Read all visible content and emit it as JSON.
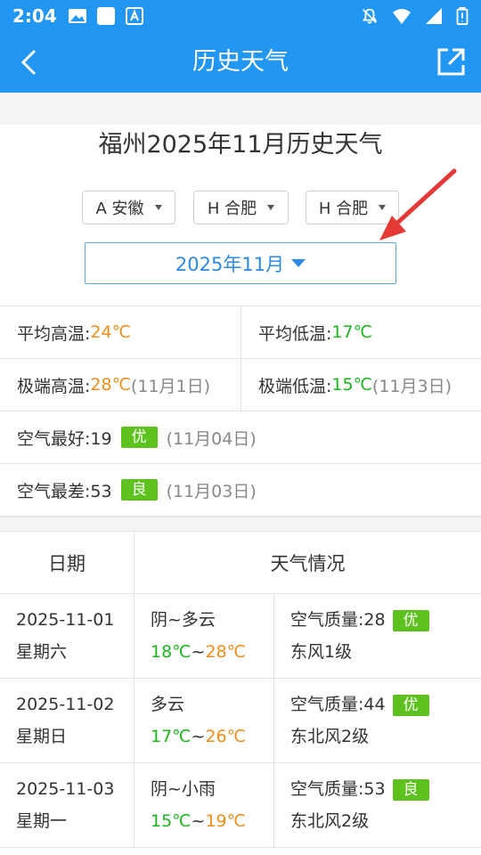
{
  "status": {
    "time": "2:04"
  },
  "app_bar": {
    "title": "历史天气"
  },
  "heading": "福州2025年11月历史天气",
  "selectors": {
    "province": "A 安徽",
    "city": "H 合肥",
    "district": "H 合肥",
    "month": "2025年11月"
  },
  "stats": {
    "avg_high_label": "平均高温:",
    "avg_high": "24℃",
    "avg_low_label": "平均低温:",
    "avg_low": "17℃",
    "ext_high_label": "极端高温:",
    "ext_high": "28℃",
    "ext_high_date": "(11月1日)",
    "ext_low_label": "极端低温:",
    "ext_low": "15℃",
    "ext_low_date": "(11月3日)",
    "air_best_label": "空气最好:19",
    "air_best_badge": "优",
    "air_best_date": "(11月04日)",
    "air_worst_label": "空气最差:53",
    "air_worst_badge": "良",
    "air_worst_date": "(11月03日)"
  },
  "table": {
    "header_date": "日期",
    "header_weather": "天气情况",
    "rows": [
      {
        "date": "2025-11-01",
        "weekday": "星期六",
        "cond": "阴~多云",
        "low": "18℃",
        "sep": "~",
        "high": "28℃",
        "aq": "空气质量:28",
        "aq_badge": "优",
        "wind": "东风1级"
      },
      {
        "date": "2025-11-02",
        "weekday": "星期日",
        "cond": "多云",
        "low": "17℃",
        "sep": "~",
        "high": "26℃",
        "aq": "空气质量:44",
        "aq_badge": "优",
        "wind": "东北风2级"
      },
      {
        "date": "2025-11-03",
        "weekday": "星期一",
        "cond": "阴~小雨",
        "low": "15℃",
        "sep": "~",
        "high": "19℃",
        "aq": "空气质量:53",
        "aq_badge": "良",
        "wind": "东北风2级"
      }
    ]
  },
  "colors": {
    "primary": "#2196f3",
    "warm": "#f08c1a",
    "cool": "#1ab71a",
    "badge": "#5ec21e",
    "annotation_arrow": "#e53935"
  }
}
